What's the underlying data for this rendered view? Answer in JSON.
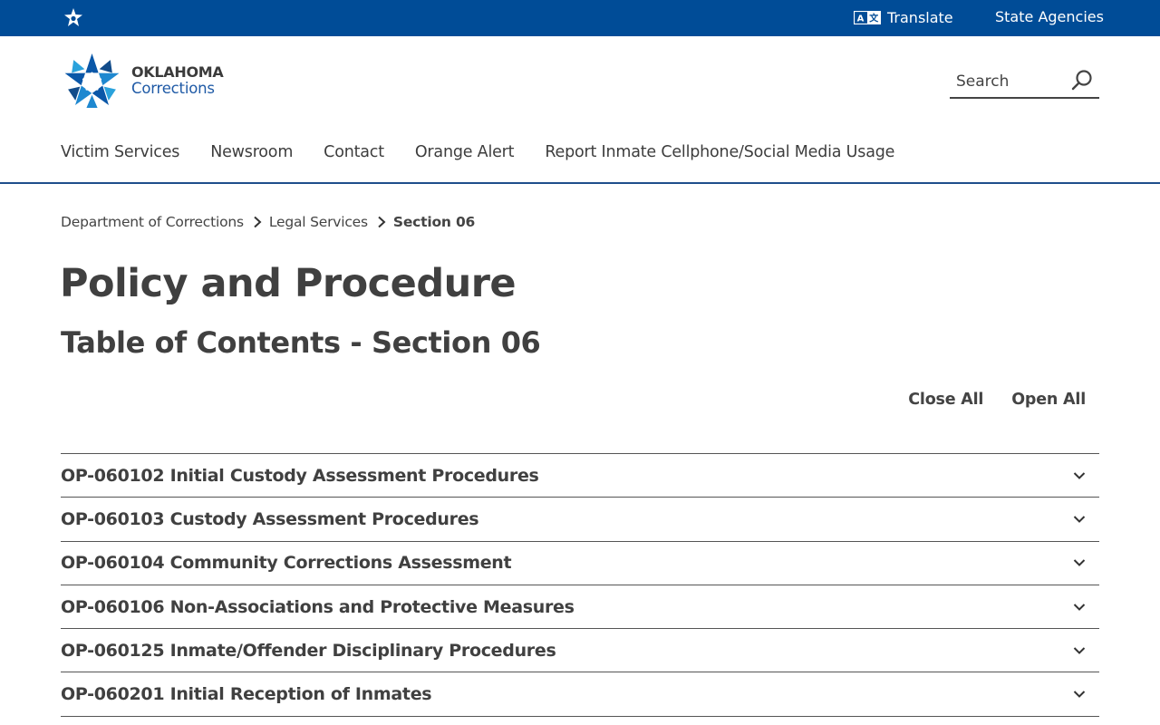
{
  "topbar": {
    "home_icon": "oklahoma-star-icon",
    "translate_icon": "translate-icon",
    "translate_label": "Translate",
    "agencies_label": "State Agencies",
    "background": "#004c97"
  },
  "header": {
    "logo_line1": "OKLAHOMA",
    "logo_line2": "Corrections",
    "search_placeholder": "Search",
    "search_icon": "search-icon"
  },
  "nav": {
    "items": [
      {
        "label": "Victim Services"
      },
      {
        "label": "Newsroom"
      },
      {
        "label": "Contact"
      },
      {
        "label": "Orange Alert"
      },
      {
        "label": "Report Inmate Cellphone/Social Media Usage"
      }
    ]
  },
  "breadcrumb": {
    "items": [
      "Department of Corrections",
      "Legal Services"
    ],
    "current": "Section 06"
  },
  "page": {
    "title": "Policy and Procedure",
    "subtitle": "Table of Contents - Section 06",
    "close_all": "Close All",
    "open_all": "Open All"
  },
  "accordion": [
    {
      "title": "OP-060102 Initial Custody Assessment Procedures"
    },
    {
      "title": "OP-060103 Custody Assessment Procedures"
    },
    {
      "title": "OP-060104 Community Corrections Assessment"
    },
    {
      "title": "OP-060106 Non-Associations and Protective Measures"
    },
    {
      "title": "OP-060125 Inmate/Offender Disciplinary Procedures"
    },
    {
      "title": "OP-060201 Initial Reception of Inmates"
    }
  ],
  "colors": {
    "brand_blue": "#004c97",
    "logo_blue": "#1f5aa6",
    "text": "#404040"
  }
}
